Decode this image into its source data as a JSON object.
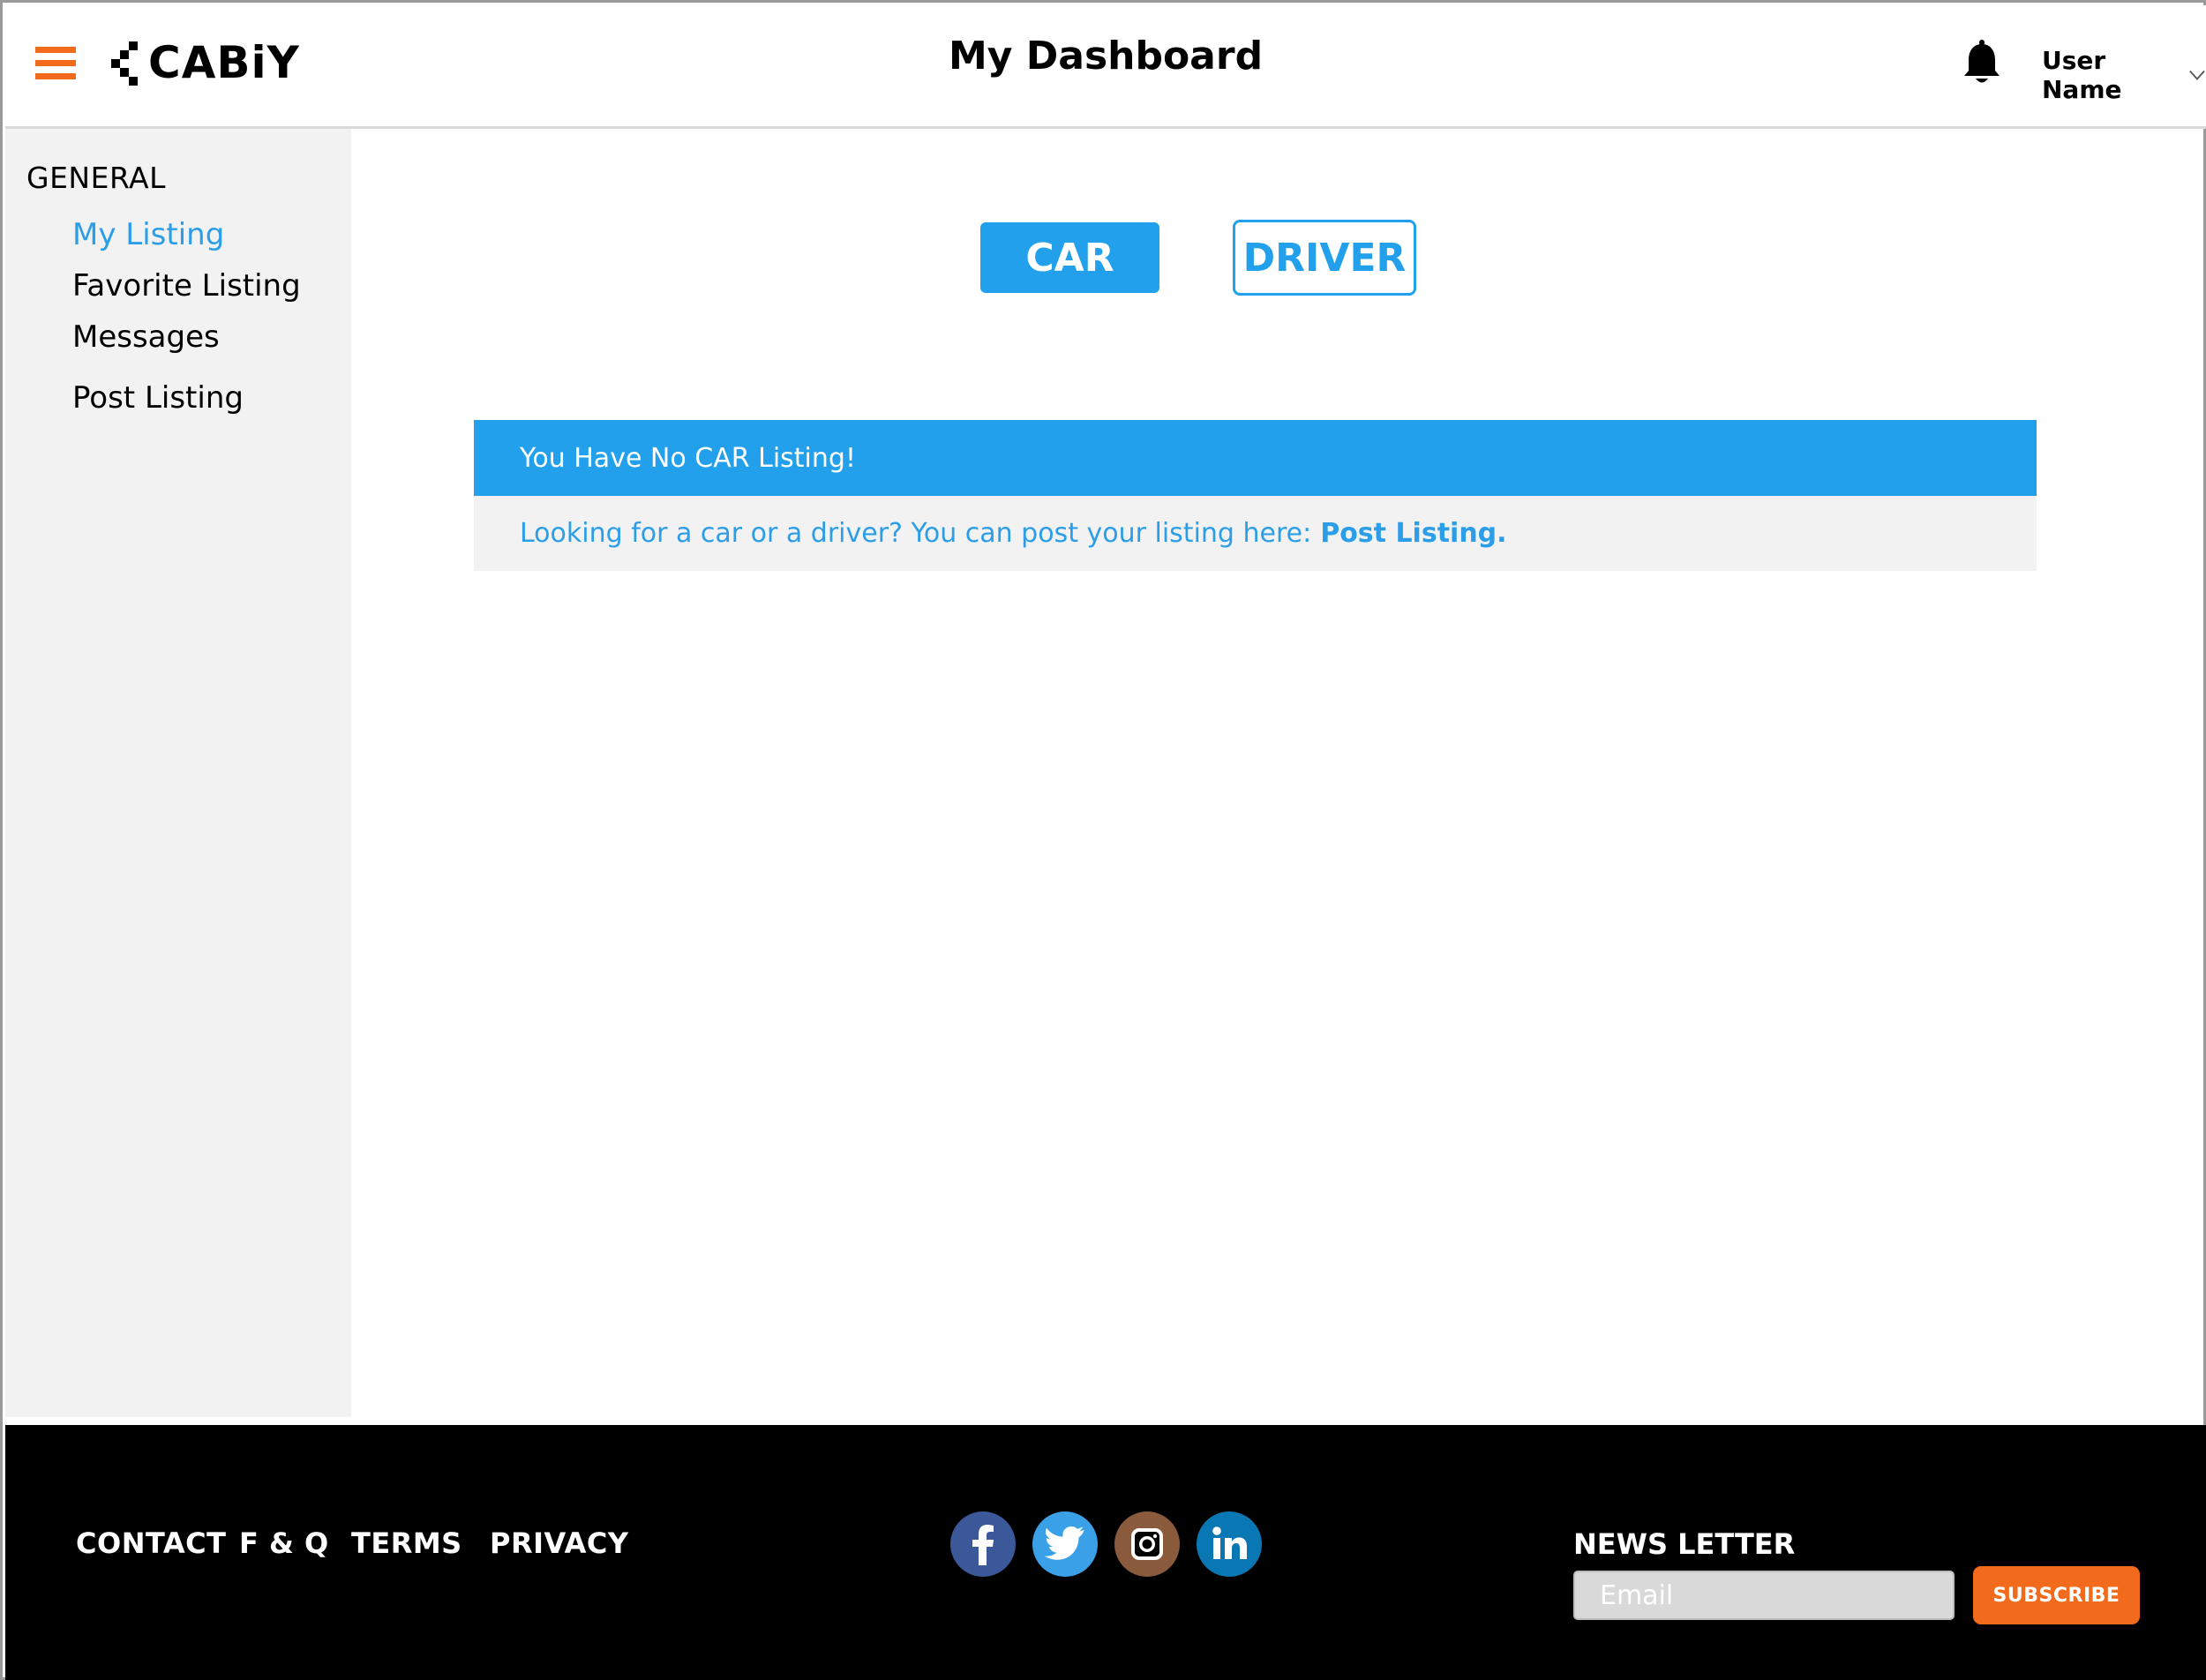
{
  "header": {
    "logo_text": "CABiY",
    "title": "My Dashboard",
    "user_name": "User Name"
  },
  "sidebar": {
    "section": "GENERAL",
    "items": [
      {
        "label": "My Listing",
        "active": true
      },
      {
        "label": "Favorite Listing",
        "active": false
      },
      {
        "label": "Messages",
        "active": false
      },
      {
        "label": "Post Listing",
        "active": false
      }
    ]
  },
  "main": {
    "tabs": [
      {
        "label": "CAR",
        "selected": true
      },
      {
        "label": "DRIVER",
        "selected": false
      }
    ],
    "notice": {
      "heading": "You Have No CAR Listing!",
      "body": "Looking for a car or a driver? You can post your listing here:",
      "link": "Post Listing."
    }
  },
  "footer": {
    "links": [
      "CONTACT",
      "F & Q",
      "TERMS",
      "PRIVACY"
    ],
    "social": [
      {
        "icon": "facebook-icon",
        "color": "#3b5998"
      },
      {
        "icon": "twitter-icon",
        "color": "#3aa0e8"
      },
      {
        "icon": "instagram-icon",
        "color": "#8a5a3c"
      },
      {
        "icon": "linkedin-icon",
        "color": "#0a77b5"
      }
    ],
    "newsletter_label": "NEWS LETTER",
    "email_placeholder": "Email",
    "subscribe_label": "SUBSCRIBE"
  },
  "colors": {
    "accent": "#22a0ec",
    "orange": "#f26a1b",
    "sidebar_bg": "#f2f2f2"
  }
}
